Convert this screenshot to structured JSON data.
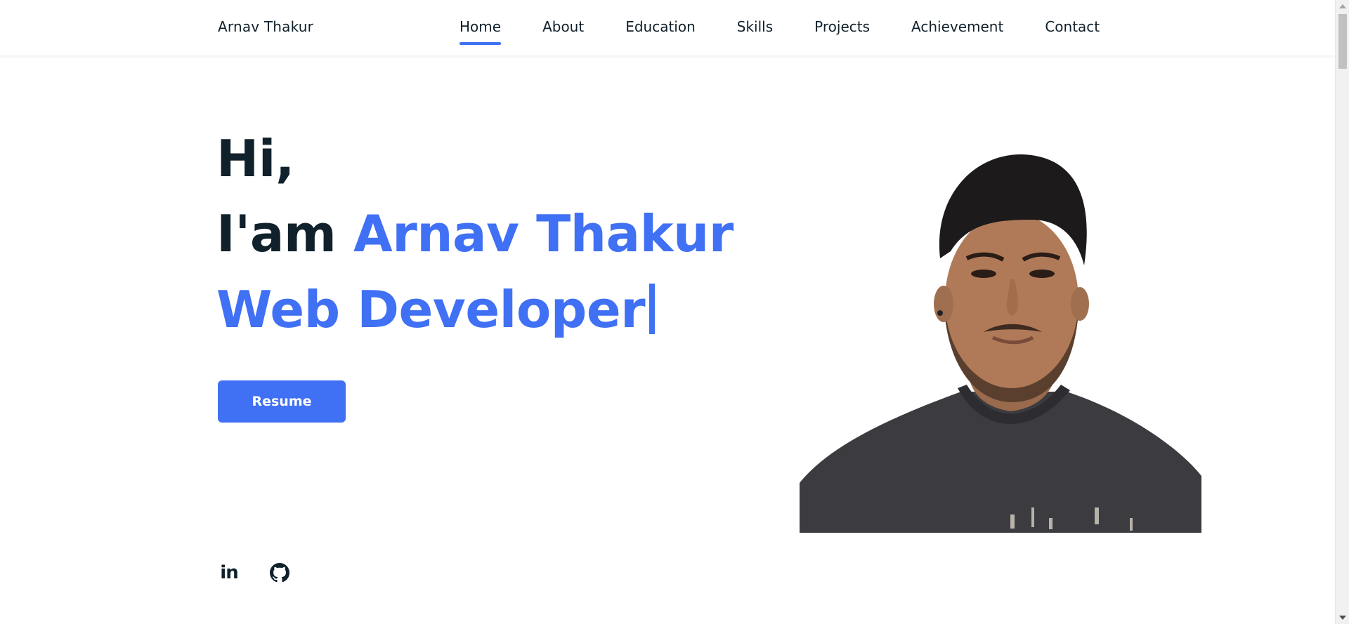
{
  "header": {
    "logo": "Arnav Thakur",
    "nav": [
      {
        "label": "Home",
        "active": true
      },
      {
        "label": "About",
        "active": false
      },
      {
        "label": "Education",
        "active": false
      },
      {
        "label": "Skills",
        "active": false
      },
      {
        "label": "Projects",
        "active": false
      },
      {
        "label": "Achievement",
        "active": false
      },
      {
        "label": "Contact",
        "active": false
      }
    ]
  },
  "hero": {
    "greeting": "Hi,",
    "intro": "I'am",
    "name": "Arnav Thakur",
    "role": "Web Developer",
    "resume_label": "Resume"
  },
  "social": {
    "linkedin_icon": "linkedin-icon",
    "github_icon": "github-icon"
  },
  "colors": {
    "accent": "#4070f4",
    "text": "#10212b",
    "background": "#ffffff"
  }
}
